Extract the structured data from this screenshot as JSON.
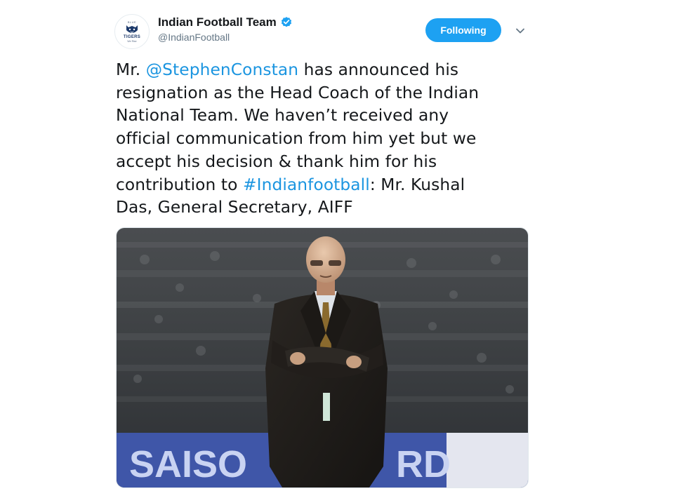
{
  "profile": {
    "name": "Indian Football Team",
    "handle": "@IndianFootball",
    "verified_icon": "verified-badge-icon",
    "avatar_top": "BLUE",
    "avatar_word": "TIGERS",
    "avatar_sub": "We Rise"
  },
  "follow_button": "Following",
  "more_icon": "chevron-down-icon",
  "tweet": {
    "part1": "Mr. ",
    "mention": "@StephenConstan",
    "part2": " has announced his\nresignation as the Head Coach of the Indian\nNational Team. We haven’t received any\nofficial communication from him yet but we\naccept his decision & thank him for his\ncontribution to ",
    "hashtag": "#Indianfootball",
    "part3": ": Mr. Kushal\nDas, General Secretary, AIFF"
  },
  "media": {
    "banner_text": "SAISO",
    "banner_text_2": "RD"
  },
  "colors": {
    "accent": "#1da1f2",
    "link": "#1b95e0",
    "text": "#14171a",
    "secondary": "#657786"
  }
}
